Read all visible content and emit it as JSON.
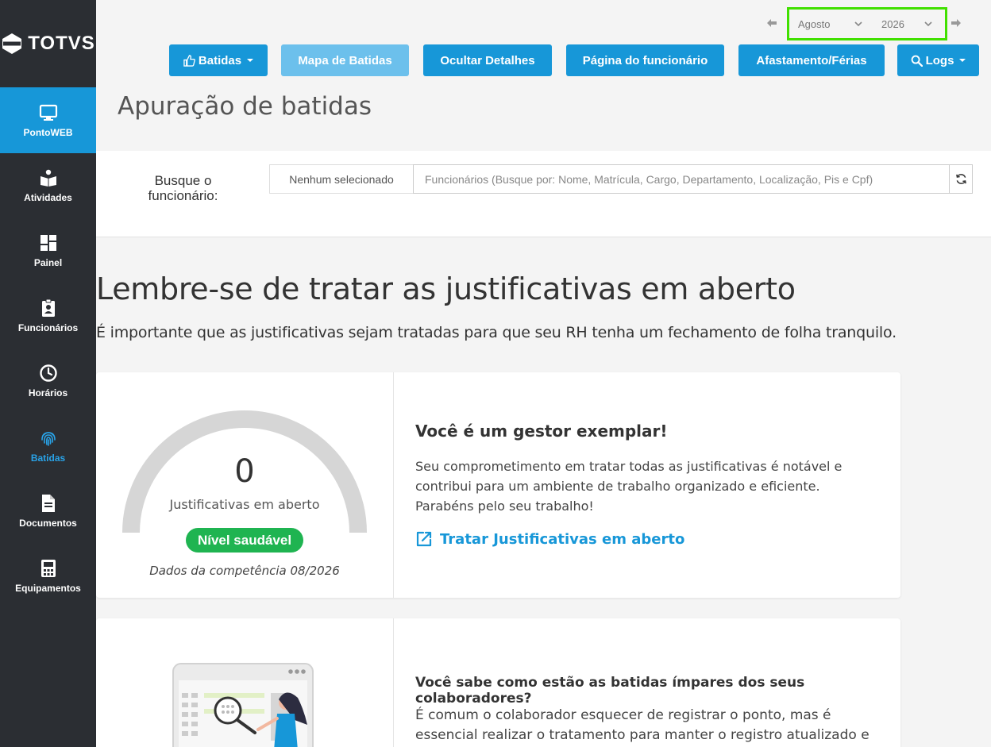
{
  "brand": {
    "name": "TOTVS"
  },
  "sidebar": {
    "items": [
      {
        "label": "PontoWEB",
        "icon": "monitor-icon"
      },
      {
        "label": "Atividades",
        "icon": "reading-icon"
      },
      {
        "label": "Painel",
        "icon": "dashboard-icon"
      },
      {
        "label": "Funcionários",
        "icon": "badge-icon"
      },
      {
        "label": "Horários",
        "icon": "clock-icon"
      },
      {
        "label": "Batidas",
        "icon": "fingerprint-icon"
      },
      {
        "label": "Documentos",
        "icon": "document-icon"
      },
      {
        "label": "Equipamentos",
        "icon": "device-icon"
      }
    ]
  },
  "period": {
    "month": "Agosto",
    "year": "2026"
  },
  "toolbar": {
    "batidas": "Batidas",
    "mapa": "Mapa de Batidas",
    "ocultar": "Ocultar Detalhes",
    "pagina": "Página do funcionário",
    "afastamento": "Afastamento/Férias",
    "logs": "Logs"
  },
  "page": {
    "title": "Apuração de batidas"
  },
  "search": {
    "label": "Busque o funcionário:",
    "selected": "Nenhum selecionado",
    "placeholder": "Funcionários (Busque por: Nome, Matrícula, Cargo, Departamento, Localização, Pis e Cpf)"
  },
  "reminder": {
    "headline": "Lembre-se de tratar as justificativas em aberto",
    "subline": "É importante que as justificativas sejam tratadas para que seu RH tenha um fechamento de folha tranquilo."
  },
  "justificativas": {
    "count": "0",
    "label": "Justificativas em aberto",
    "badge": "Nível saudável",
    "competencia": "Dados da competência 08/2026",
    "title": "Você é um gestor exemplar!",
    "body": "Seu comprometimento em tratar todas as justificativas é notável e contribui para um ambiente de trabalho organizado e eficiente. Parabéns pelo seu trabalho!",
    "link": "Tratar Justificativas em aberto"
  },
  "impares": {
    "title": "Você sabe como estão as batidas ímpares dos seus colaboradores?",
    "body": "É comum o colaborador esquecer de registrar o ponto, mas é essencial realizar o tratamento para manter o registro atualizado e preciso, você"
  },
  "colors": {
    "primary": "#1797d8",
    "primary_light": "#6cc0ec",
    "success": "#1fb451",
    "sidebar": "#2b2e33",
    "highlight": "#41e000"
  }
}
